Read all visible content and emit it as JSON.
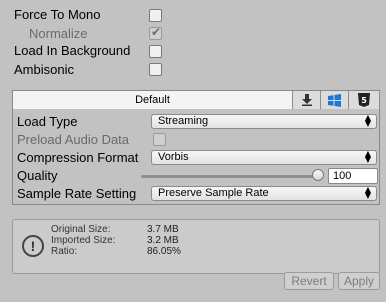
{
  "settings": {
    "force_to_mono": {
      "label": "Force To Mono",
      "checked": false
    },
    "normalize": {
      "label": "Normalize",
      "checked": true,
      "disabled": true
    },
    "load_in_background": {
      "label": "Load In Background",
      "checked": false
    },
    "ambisonic": {
      "label": "Ambisonic",
      "checked": false
    }
  },
  "platform_tabs": {
    "default_label": "Default",
    "icons": [
      "download-icon",
      "windows-icon",
      "html5-icon"
    ]
  },
  "panel": {
    "load_type": {
      "label": "Load Type",
      "value": "Streaming"
    },
    "preload_audio_data": {
      "label": "Preload Audio Data",
      "checked": false,
      "disabled": true
    },
    "compression_format": {
      "label": "Compression Format",
      "value": "Vorbis"
    },
    "quality": {
      "label": "Quality",
      "value": "100",
      "slider_fraction": 1.0
    },
    "sample_rate_setting": {
      "label": "Sample Rate Setting",
      "value": "Preserve Sample Rate"
    }
  },
  "info": {
    "original_size": {
      "label": "Original Size:",
      "value": "3.7 MB"
    },
    "imported_size": {
      "label": "Imported Size:",
      "value": "3.2 MB"
    },
    "ratio": {
      "label": "Ratio:",
      "value": "86.05%"
    }
  },
  "buttons": {
    "revert": "Revert",
    "apply": "Apply"
  }
}
